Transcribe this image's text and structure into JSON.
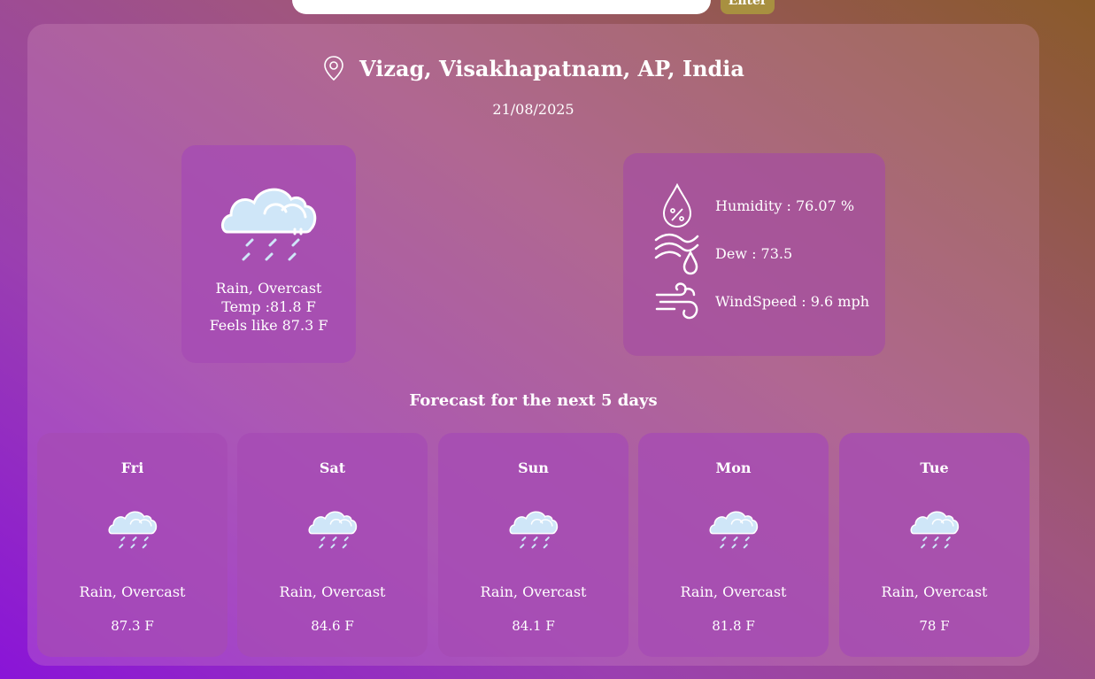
{
  "search": {
    "value": "",
    "button_label": "Enter"
  },
  "location": {
    "name": "Vizag, Visakhapatnam, AP, India",
    "icon": "location-pin-icon"
  },
  "date": "21/08/2025",
  "current": {
    "icon": "rain-overcast-icon",
    "condition": "Rain, Overcast",
    "temp": "Temp :81.8 F",
    "feels_like": "Feels like 87.3 F"
  },
  "stats": [
    {
      "icon": "humidity-icon",
      "label": "Humidity : 76.07 %"
    },
    {
      "icon": "dew-icon",
      "label": "Dew : 73.5"
    },
    {
      "icon": "wind-icon",
      "label": "WindSpeed : 9.6 mph"
    }
  ],
  "forecast": {
    "title": "Forecast for the next 5 days",
    "days": [
      {
        "day": "Fri",
        "condition": "Rain, Overcast",
        "temp": "87.3 F",
        "icon": "rain-overcast-icon"
      },
      {
        "day": "Sat",
        "condition": "Rain, Overcast",
        "temp": "84.6 F",
        "icon": "rain-overcast-icon"
      },
      {
        "day": "Sun",
        "condition": "Rain, Overcast",
        "temp": "84.1 F",
        "icon": "rain-overcast-icon"
      },
      {
        "day": "Mon",
        "condition": "Rain, Overcast",
        "temp": "81.8 F",
        "icon": "rain-overcast-icon"
      },
      {
        "day": "Tue",
        "condition": "Rain, Overcast",
        "temp": "78 F",
        "icon": "rain-overcast-icon"
      }
    ]
  },
  "colors": {
    "card": "#a54bb4",
    "button": "#a89040",
    "cloud": "#cfe6f8"
  }
}
